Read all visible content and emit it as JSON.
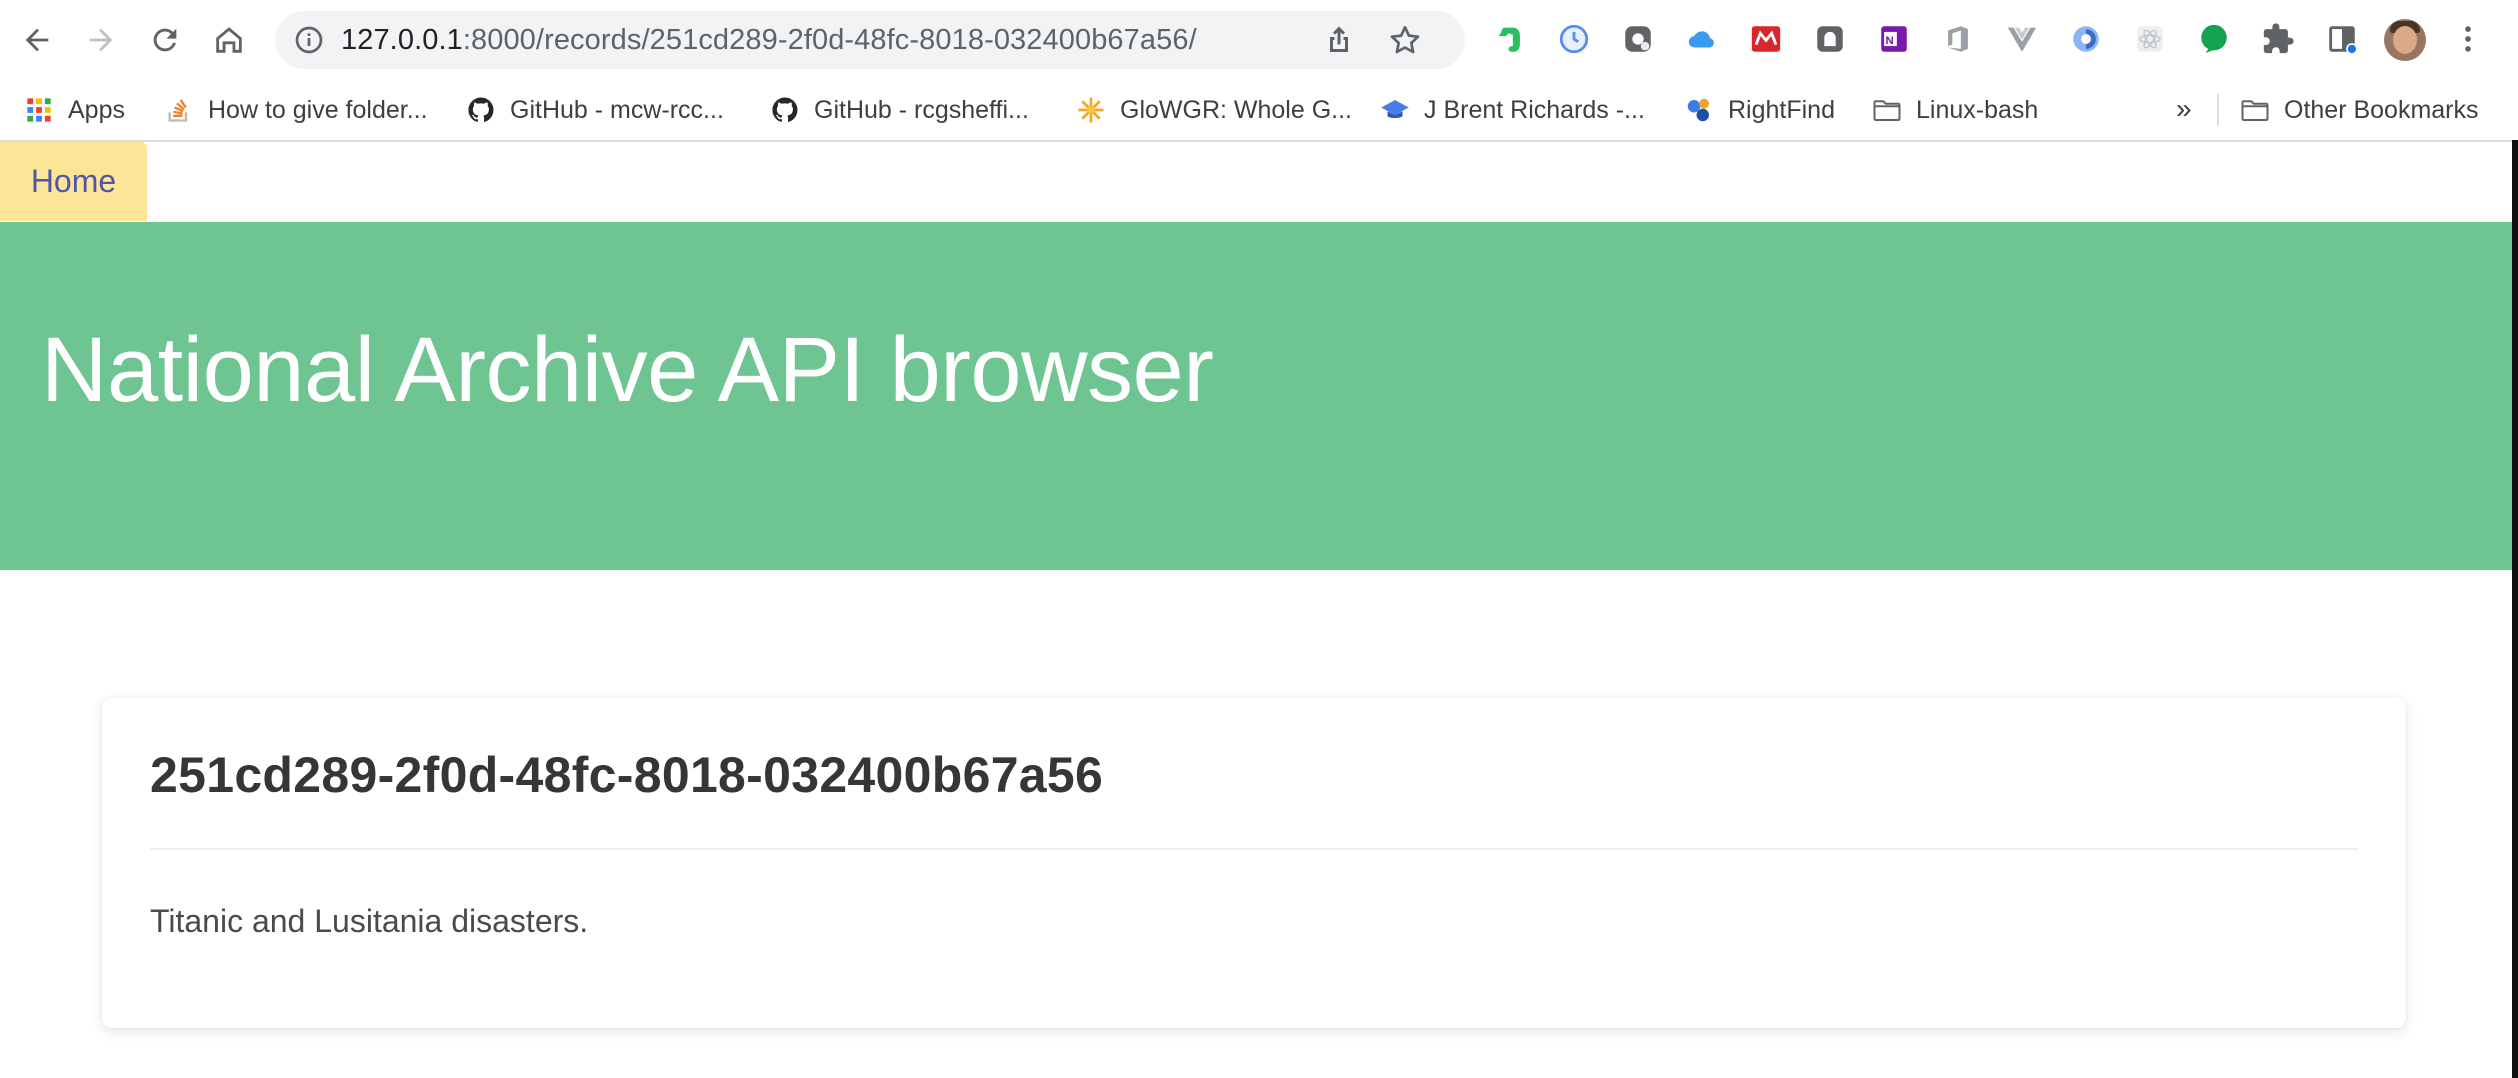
{
  "browser": {
    "url_host": "127.0.0.1",
    "url_path": ":8000/records/251cd289-2f0d-48fc-8018-032400b67a56/",
    "bookmarks": [
      {
        "label": "Apps",
        "icon": "apps-grid-icon"
      },
      {
        "label": "How to give folder...",
        "icon": "stackoverflow-icon"
      },
      {
        "label": "GitHub - mcw-rcc...",
        "icon": "github-icon"
      },
      {
        "label": "GitHub - rcgsheffi...",
        "icon": "github-icon"
      },
      {
        "label": "GloWGR: Whole G...",
        "icon": "sunburst-icon"
      },
      {
        "label": "J Brent Richards -...",
        "icon": "mortarboard-icon"
      },
      {
        "label": "RightFind",
        "icon": "rightfind-icon"
      },
      {
        "label": "Linux-bash",
        "icon": "folder-icon"
      }
    ],
    "bookmarks_overflow": "»",
    "other_bookmarks": "Other Bookmarks",
    "extensions": [
      "evernote-icon",
      "clock-extension-icon",
      "dropbox-extension-icon",
      "icloud-icon",
      "mendeley-icon",
      "ghostery-icon",
      "onenote-icon",
      "office-icon",
      "vue-devtools-icon",
      "zotero-icon",
      "react-devtools-icon",
      "grammarly-icon",
      "extensions-puzzle-icon",
      "tab-search-icon"
    ]
  },
  "page": {
    "home_label": "Home",
    "hero_title": "National Archive API browser",
    "record": {
      "id": "251cd289-2f0d-48fc-8018-032400b67a56",
      "description": "Titanic and Lusitania disasters."
    }
  }
}
